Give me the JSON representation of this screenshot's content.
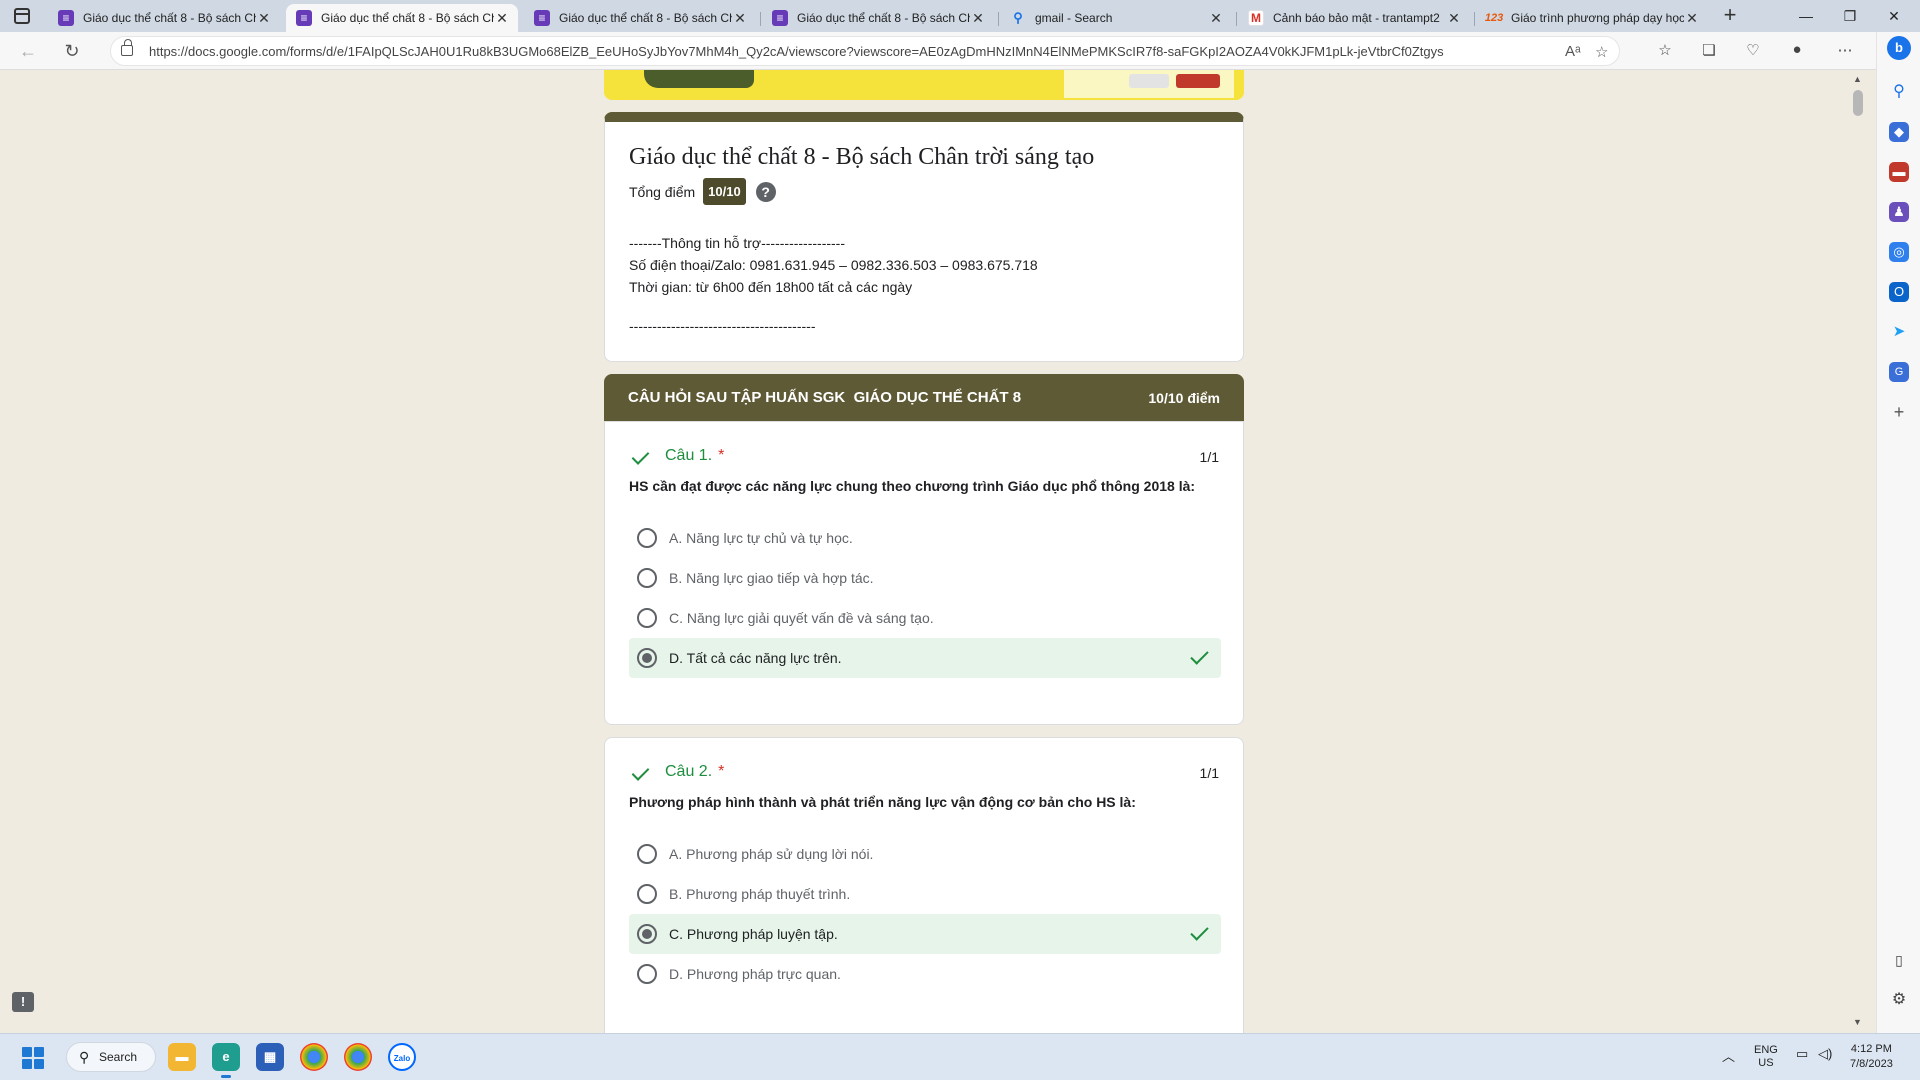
{
  "browser": {
    "tabs": [
      {
        "title": "Giáo dục thể chất 8 - Bộ sách Ch",
        "icon": "forms-icon",
        "active": false
      },
      {
        "title": "Giáo dục thể chất 8 - Bộ sách Ch",
        "icon": "forms-icon",
        "active": true
      },
      {
        "title": "Giáo dục thể chất 8 - Bộ sách Ch",
        "icon": "forms-icon",
        "active": false
      },
      {
        "title": "Giáo dục thể chất 8 - Bộ sách Ch",
        "icon": "forms-icon",
        "active": false
      },
      {
        "title": "gmail - Search",
        "icon": "search-icon",
        "active": false
      },
      {
        "title": "Cảnh báo bảo mật - trantampt2",
        "icon": "gmail-icon",
        "active": false
      },
      {
        "title": "Giáo trình phương pháp dạy học",
        "icon": "numbers-icon",
        "active": false
      }
    ],
    "url": "https://docs.google.com/forms/d/e/1FAIpQLScJAH0U1Ru8kB3UGMo68ElZB_EeUHoSyJbYov7MhM4h_Qy2cA/viewscore?viewscore=AE0zAgDmHNzIMnN4ElNMePMKScIR7f8-saFGKpI2AOZA4V0kKJFM1pLk-jeVtbrCf0Ztgys"
  },
  "form": {
    "title": "Giáo dục thể chất 8 - Bộ sách Chân trời sáng tạo",
    "score_label": "Tổng điểm",
    "score_value": "10/10",
    "desc_line1": "-------Thông tin hỗ trợ------------------",
    "desc_line2": "Số điện thoại/Zalo: 0981.631.945 – 0982.336.503 – 0983.675.718",
    "desc_line3": "Thời gian: từ 6h00 đến 18h00 tất cả các ngày",
    "desc_divider": "----------------------------------------",
    "section_title": "CÂU HỎI SAU TẬP HUẤN SGK  GIÁO DỤC THỂ CHẤT 8",
    "section_score": "10/10 điểm",
    "questions": [
      {
        "number": "Câu 1.",
        "required": "*",
        "points": "1/1",
        "text": "HS cần đạt được các năng lực chung theo chương trình Giáo dục phổ thông 2018 là:",
        "options": [
          "A. Năng lực tự chủ và tự học.",
          "B. Năng lực giao tiếp và hợp tác.",
          "C. Năng lực giải quyết vấn đề và sáng tạo.",
          "D. Tất cả các năng lực trên."
        ],
        "selected_index": 3
      },
      {
        "number": "Câu 2.",
        "required": "*",
        "points": "1/1",
        "text": "Phương pháp hình thành và phát triển năng lực vận động cơ bản cho HS là:",
        "options": [
          "A. Phương pháp sử dụng lời nói.",
          "B. Phương pháp thuyết trình.",
          "C. Phương pháp luyện tập.",
          "D. Phương pháp trực quan."
        ],
        "selected_index": 2
      }
    ]
  },
  "taskbar": {
    "search_label": "Search",
    "lang_top": "ENG",
    "lang_bottom": "US",
    "time": "4:12 PM",
    "date": "7/8/2023"
  },
  "colors": {
    "theme": "#5e5a35",
    "correct_bg": "#e6f4ea",
    "correct_check": "#1e8e3e",
    "page_bg": "#f0ebe0"
  }
}
